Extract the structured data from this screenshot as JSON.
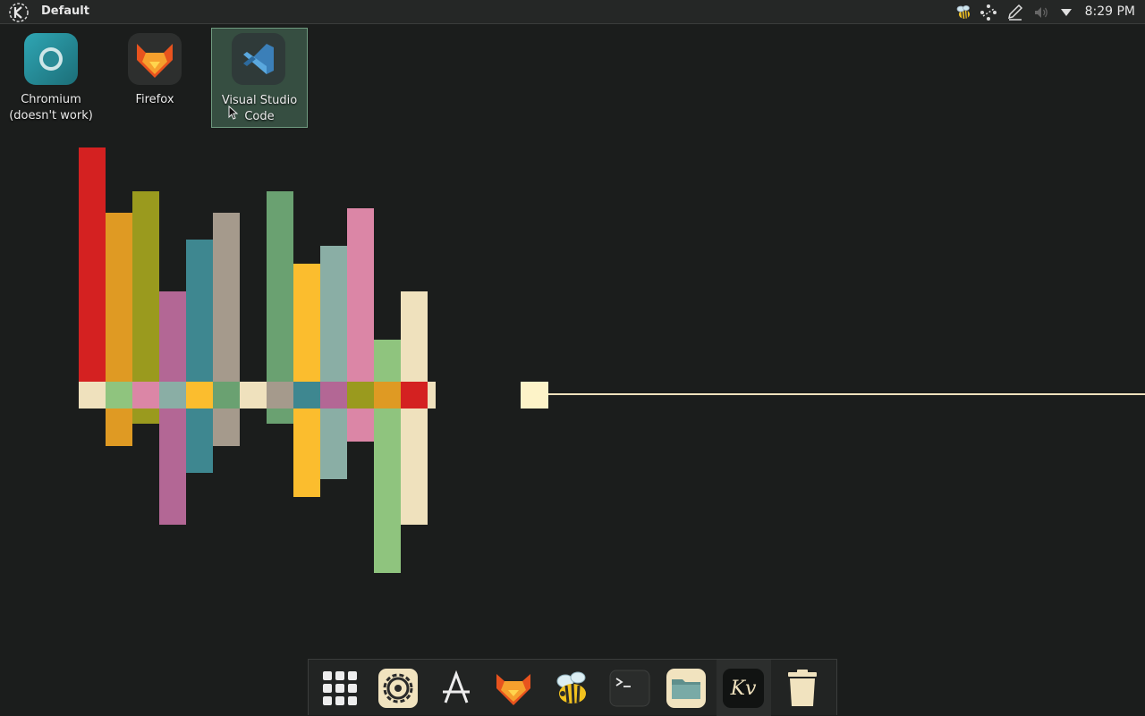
{
  "panel": {
    "title": "Default",
    "clock": "8:29 PM",
    "tray_icons": [
      "bee-icon",
      "network-icon",
      "pen-icon",
      "volume-icon",
      "expand-tray-icon"
    ]
  },
  "desktop_icons": [
    {
      "name": "chromium",
      "label_line1": "Chromium",
      "label_line2": "(doesn't work)",
      "icon": "chromium-icon"
    },
    {
      "name": "firefox",
      "label_line1": "Firefox",
      "label_line2": "",
      "icon": "firefox-icon"
    },
    {
      "name": "vscode",
      "label_line1": "Visual Studio",
      "label_line2": "Code",
      "icon": "vscode-icon",
      "selected": true
    }
  ],
  "dock": {
    "items": [
      {
        "name": "app-grid",
        "icon": "grid-icon"
      },
      {
        "name": "settings",
        "icon": "gear-icon"
      },
      {
        "name": "app-store",
        "icon": "store-icon"
      },
      {
        "name": "firefox",
        "icon": "firefox-icon"
      },
      {
        "name": "bee-app",
        "icon": "bee-icon"
      },
      {
        "name": "terminal",
        "icon": "terminal-icon",
        "glyph": ">_"
      },
      {
        "name": "files",
        "icon": "folder-icon"
      },
      {
        "name": "kv-app",
        "icon": "kv-icon",
        "glyph": "Kv",
        "active": true
      },
      {
        "name": "trash",
        "icon": "trash-icon"
      }
    ]
  },
  "colors": {
    "background": "#1b1d1c",
    "panel": "#252726",
    "wallpaper_red": "#d42121",
    "wallpaper_orange": "#df9a23",
    "wallpaper_olive": "#9a9a1e",
    "wallpaper_mauve": "#b36795",
    "wallpaper_teal": "#3e8790",
    "wallpaper_taupe": "#a59a8c",
    "wallpaper_green": "#6aa171",
    "wallpaper_yellow": "#fbbd2e",
    "wallpaper_sage": "#8aaea5",
    "wallpaper_pink": "#db86a6",
    "wallpaper_lightgreen": "#8fc47e",
    "wallpaper_cream": "#efe1bd"
  }
}
